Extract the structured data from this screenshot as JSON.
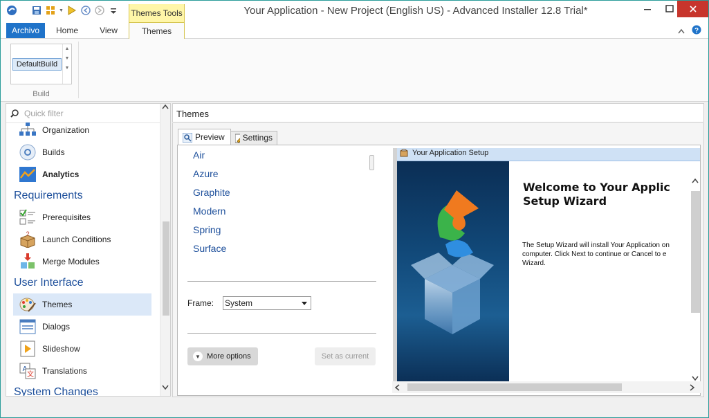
{
  "titlebar": {
    "title": "Your Application - New Project (English US) - Advanced Installer 12.8 Trial*",
    "context_tab": "Themes Tools",
    "quick_access": [
      "app-logo-icon",
      "save-icon",
      "build-icon",
      "run-icon",
      "back-icon",
      "forward-icon",
      "customize-icon"
    ]
  },
  "ribbon": {
    "tabs": [
      "Archivo",
      "Home",
      "View",
      "Themes"
    ],
    "build": {
      "selected": "DefaultBuild",
      "group_label": "Build"
    }
  },
  "left_panel": {
    "filter_placeholder": "Quick filter",
    "items": {
      "organization": "Organization",
      "builds": "Builds",
      "analytics": "Analytics",
      "cat_requirements": "Requirements",
      "prerequisites": "Prerequisites",
      "launch_conditions": "Launch Conditions",
      "merge_modules": "Merge Modules",
      "cat_user_interface": "User Interface",
      "themes": "Themes",
      "dialogs": "Dialogs",
      "slideshow": "Slideshow",
      "translations": "Translations",
      "cat_system_changes": "System Changes"
    }
  },
  "main": {
    "header": "Themes",
    "tabs": {
      "preview": "Preview",
      "settings": "Settings"
    },
    "themes": [
      "Air",
      "Azure",
      "Graphite",
      "Modern",
      "Spring",
      "Surface"
    ],
    "frame_label": "Frame:",
    "frame_value": "System",
    "more_options": "More options",
    "set_as_current": "Set as current",
    "preview": {
      "window_title": "Your Application Setup",
      "heading": "Welcome to Your Applic\nSetup Wizard",
      "body": "The Setup Wizard will install Your Application on\ncomputer. Click Next to continue or Cancel to e\nWizard."
    }
  },
  "colors": {
    "accent": "#1f73c9",
    "context_tab": "#fff6a8",
    "close_button": "#c7352c",
    "category_text": "#1d4f9b",
    "selection": "#dbe8f8"
  }
}
